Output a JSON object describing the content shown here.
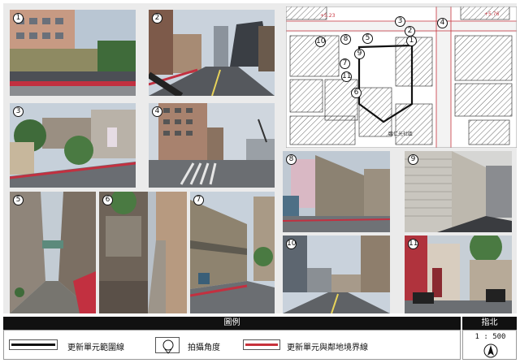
{
  "photos": [
    {
      "label": "1"
    },
    {
      "label": "2"
    },
    {
      "label": "3"
    },
    {
      "label": "4"
    },
    {
      "label": "5"
    },
    {
      "label": "6"
    },
    {
      "label": "7"
    },
    {
      "label": "8"
    },
    {
      "label": "9"
    },
    {
      "label": "10"
    },
    {
      "label": "11"
    }
  ],
  "map": {
    "markers": [
      "1",
      "2",
      "3",
      "4",
      "5",
      "6",
      "7",
      "8",
      "9",
      "10",
      "11"
    ],
    "small_text": [
      "+5.76",
      "+5.23",
      "臨仁光社區"
    ]
  },
  "legend": {
    "title": "圖例",
    "items": [
      {
        "label": "更新單元範圍線"
      },
      {
        "label": "拍攝角度"
      },
      {
        "label": "更新單元與鄰地境界線",
        "color": "#c8323c"
      }
    ]
  },
  "north": {
    "title": "指北",
    "scale": "1 : 500",
    "symbol": "N"
  },
  "colors": {
    "legend_bar": "#111111",
    "panel_bg": "#ebebeb",
    "boundary_red": "#c8323c"
  }
}
